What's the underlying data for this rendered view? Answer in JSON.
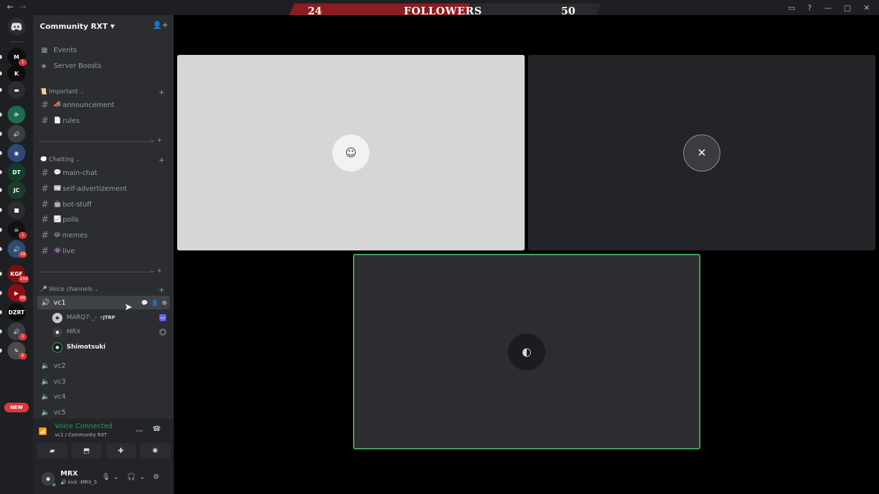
{
  "titlebar": {
    "back": "←",
    "forward": "→"
  },
  "banner": {
    "left_count": "24",
    "label": "FOLLOWERS",
    "right_count": "50"
  },
  "rail": {
    "home_icon": "discord-logo-icon",
    "servers": [
      {
        "initials": "M",
        "color": "#0d0d0d",
        "badge": "1"
      },
      {
        "initials": "K",
        "color": "#0d0d0d",
        "badge": ""
      },
      {
        "initials": "▬",
        "color": "#2b2d31",
        "badge": ""
      },
      {
        "initials": "⟳",
        "color": "#1f6b4f",
        "badge": ""
      },
      {
        "initials": "🔊",
        "color": "#3b3d44",
        "badge": ""
      },
      {
        "initials": "◉",
        "color": "#2f4a7a",
        "badge": ""
      },
      {
        "initials": "DT",
        "color": "#0e3d2e",
        "badge": ""
      },
      {
        "initials": "JC",
        "color": "#1d3b2a",
        "badge": ""
      },
      {
        "initials": "■",
        "color": "#2b2d31",
        "badge": ""
      },
      {
        "initials": "☠",
        "color": "#111",
        "badge": "1"
      },
      {
        "initials": "🔊",
        "color": "#2e4b70",
        "badge": "18"
      },
      {
        "initials": "KGF",
        "color": "#7a1010",
        "badge": "264"
      },
      {
        "initials": "▶",
        "color": "#8b0d12",
        "badge": "88"
      },
      {
        "initials": "DZRT",
        "color": "#0b0b0b",
        "badge": ""
      },
      {
        "initials": "🔊",
        "color": "#3b3d44",
        "badge": "1"
      },
      {
        "initials": "✎",
        "color": "#4a4a4a",
        "badge": "6"
      }
    ],
    "new_label": "NEW"
  },
  "guild": {
    "name": "Community RXT"
  },
  "nav": {
    "events": "Events",
    "boosts": "Server Boosts"
  },
  "categories": {
    "important": "📜 Important",
    "chatting": "💭 Chatting",
    "voice": "🎤 Voice channels"
  },
  "channels": {
    "announcement": "announcement",
    "rules": "rules",
    "main_chat": "main-chat",
    "self_ad": "self-advertizement",
    "bot_stuff": "bot-stuff",
    "polls": "polls",
    "memes": "memes",
    "live": "live"
  },
  "channel_emoji": {
    "announcement": "📣",
    "rules": "📄",
    "main_chat": "💬",
    "self_ad": "📰",
    "bot_stuff": "🤖",
    "polls": "📈",
    "memes": "😂",
    "live": "👾"
  },
  "voice_channels": {
    "vc1": "vc1",
    "vc2": "vc2",
    "vc3": "vc3",
    "vc4": "vc4",
    "vc5": "vc5"
  },
  "voice_users": [
    {
      "name": "MARQ7-_-",
      "tag": "⚡JTRP"
    },
    {
      "name": "MRX",
      "tag": ""
    },
    {
      "name": "Shimotsuki",
      "tag": ""
    }
  ],
  "voice_panel": {
    "title": "Voice Connected",
    "subtitle": "vc1 / Community RXT"
  },
  "user": {
    "name": "MRX",
    "status": "🔊 kick :MRX_S"
  },
  "accent_color": "#23a55a"
}
